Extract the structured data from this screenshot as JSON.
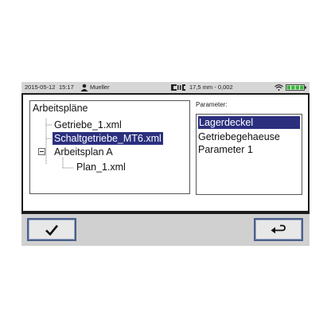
{
  "status": {
    "date": "2015-05-12",
    "time": "15:17",
    "user": "Mueller",
    "measurement": "17,5 mm - 0,002",
    "icons": {
      "user": "user-icon",
      "tool": "tool-icon",
      "wifi": "wifi-icon",
      "battery": "battery-icon"
    }
  },
  "tree": {
    "root": "Arbeitspläne",
    "items": [
      {
        "label": "Getriebe_1.xml",
        "selected": false
      },
      {
        "label": "Schaltgetriebe_MT6.xml",
        "selected": true
      },
      {
        "label": "Arbeitsplan A",
        "selected": false,
        "expanded": true
      },
      {
        "label": "Plan_1.xml",
        "selected": false
      }
    ]
  },
  "parameters": {
    "label": "Parameter:",
    "items": [
      "Lagerdeckel",
      "Getriebegehaeuse",
      "Parameter 1"
    ],
    "selected_index": 0
  },
  "buttons": {
    "confirm_icon": "check-icon",
    "back_icon": "return-arrow-icon"
  },
  "colors": {
    "selection": "#2b2f7e",
    "status_bar": "#d6d6d6",
    "frame": "#1b1b1b",
    "battery": "#3cb43c"
  }
}
